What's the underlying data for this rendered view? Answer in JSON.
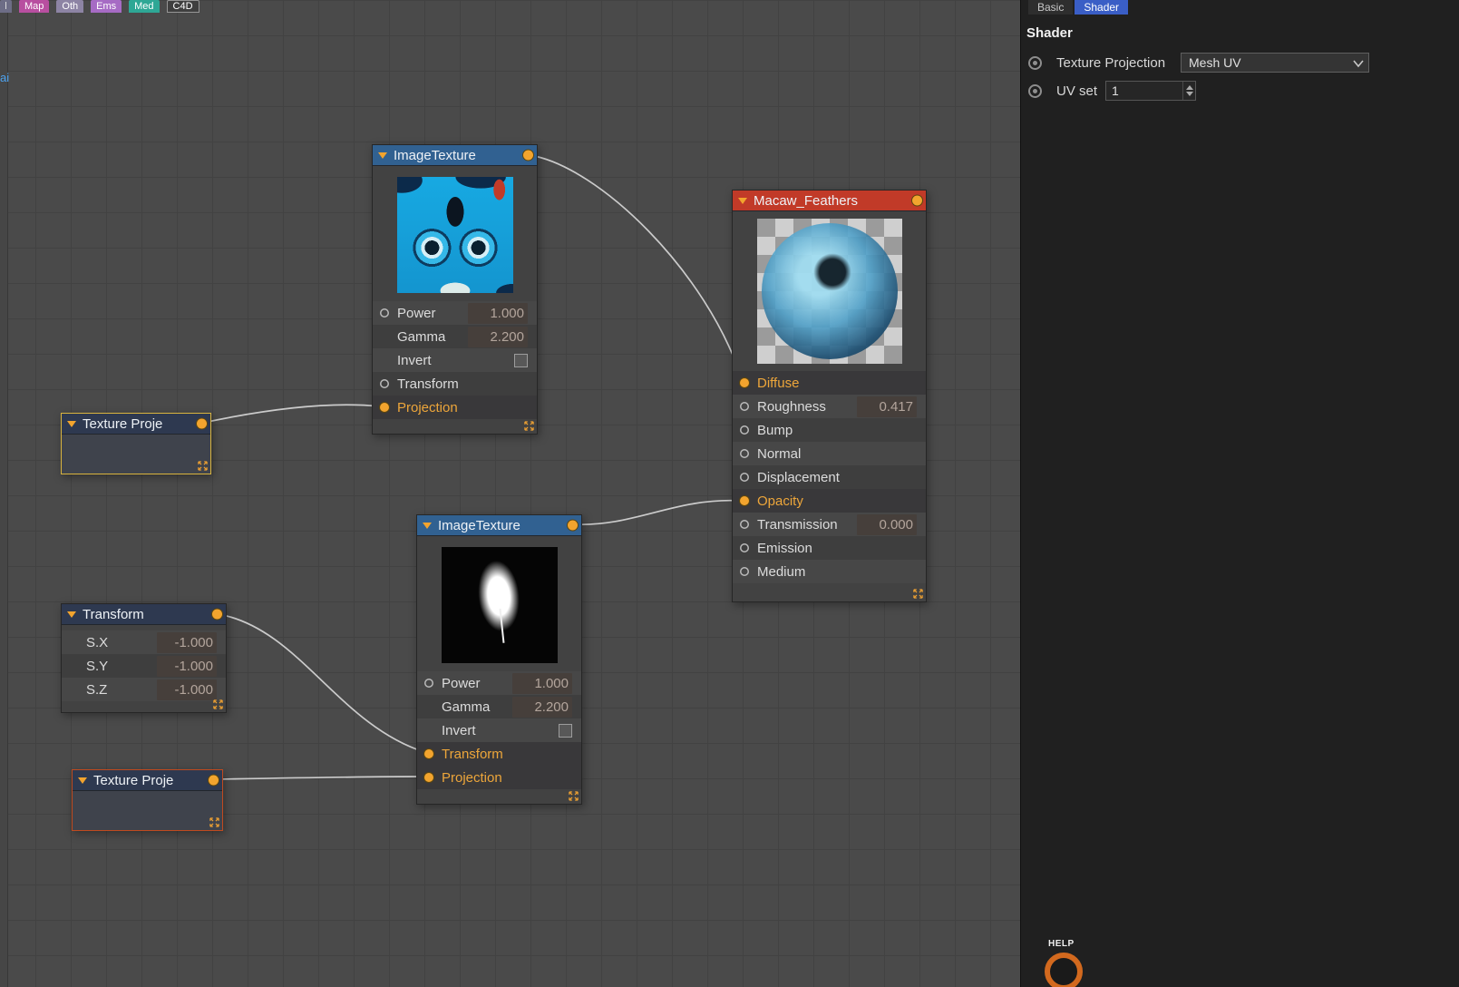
{
  "top_tabs": {
    "clipped": "l",
    "items": [
      {
        "label": "Map"
      },
      {
        "label": "Oth"
      },
      {
        "label": "Ems"
      },
      {
        "label": "Med"
      },
      {
        "label": "C4D"
      }
    ]
  },
  "left_strip": {
    "label": "ai"
  },
  "nodes": {
    "it1": {
      "title": "ImageTexture",
      "rows": [
        {
          "label": "Power",
          "value": "1.000"
        },
        {
          "label": "Gamma",
          "value": "2.200"
        },
        {
          "label": "Invert"
        },
        {
          "label": "Transform"
        },
        {
          "label": "Projection"
        }
      ]
    },
    "macaw": {
      "title": "Macaw_Feathers",
      "rows": [
        {
          "label": "Diffuse"
        },
        {
          "label": "Roughness",
          "value": "0.417"
        },
        {
          "label": "Bump"
        },
        {
          "label": "Normal"
        },
        {
          "label": "Displacement"
        },
        {
          "label": "Opacity"
        },
        {
          "label": "Transmission",
          "value": "0.000"
        },
        {
          "label": "Emission"
        },
        {
          "label": "Medium"
        }
      ]
    },
    "tp1": {
      "title": "Texture Proje"
    },
    "it2": {
      "title": "ImageTexture",
      "rows": [
        {
          "label": "Power",
          "value": "1.000"
        },
        {
          "label": "Gamma",
          "value": "2.200"
        },
        {
          "label": "Invert"
        },
        {
          "label": "Transform"
        },
        {
          "label": "Projection"
        }
      ]
    },
    "transform": {
      "title": "Transform",
      "rows": [
        {
          "label": "S.X",
          "value": "-1.000"
        },
        {
          "label": "S.Y",
          "value": "-1.000"
        },
        {
          "label": "S.Z",
          "value": "-1.000"
        }
      ]
    },
    "tp2": {
      "title": "Texture Proje"
    }
  },
  "right_panel": {
    "tabs": [
      {
        "label": "Basic"
      },
      {
        "label": "Shader"
      }
    ],
    "heading": "Shader",
    "rows": [
      {
        "label": "Texture Projection",
        "value": "Mesh UV"
      },
      {
        "label": "UV set",
        "value": "1"
      }
    ],
    "help": "HELP"
  },
  "colors": {
    "accent": "#f2a42e",
    "header_blue": "#316191",
    "header_red": "#c13a28",
    "tab_active": "#3a5ec6",
    "wire": "#cbcbcb"
  }
}
